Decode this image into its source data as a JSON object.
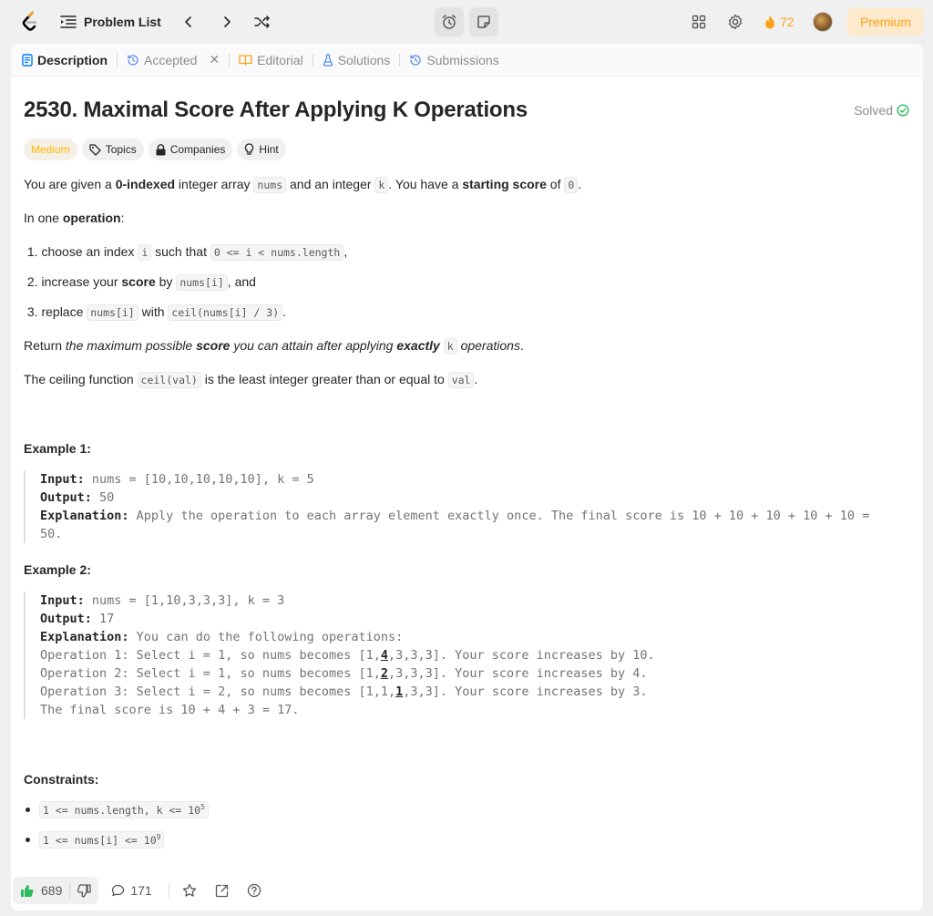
{
  "topbar": {
    "problem_list_label": "Problem List",
    "streak_count": "72",
    "premium_label": "Premium"
  },
  "tabs": {
    "description": "Description",
    "accepted": "Accepted",
    "editorial": "Editorial",
    "solutions": "Solutions",
    "submissions": "Submissions"
  },
  "problem": {
    "title": "2530. Maximal Score After Applying K Operations",
    "solved_label": "Solved",
    "difficulty": "Medium",
    "tags": {
      "topics": "Topics",
      "companies": "Companies",
      "hint": "Hint"
    }
  },
  "examples": {
    "ex1_header": "Example 1:",
    "ex2_header": "Example 2:",
    "constraints_header": "Constraints:"
  },
  "bottombar": {
    "likes": "689",
    "comments": "171"
  },
  "colors": {
    "accent": "#ffa116",
    "solved_green": "#2cbb5d",
    "medium": "#ffb800"
  }
}
